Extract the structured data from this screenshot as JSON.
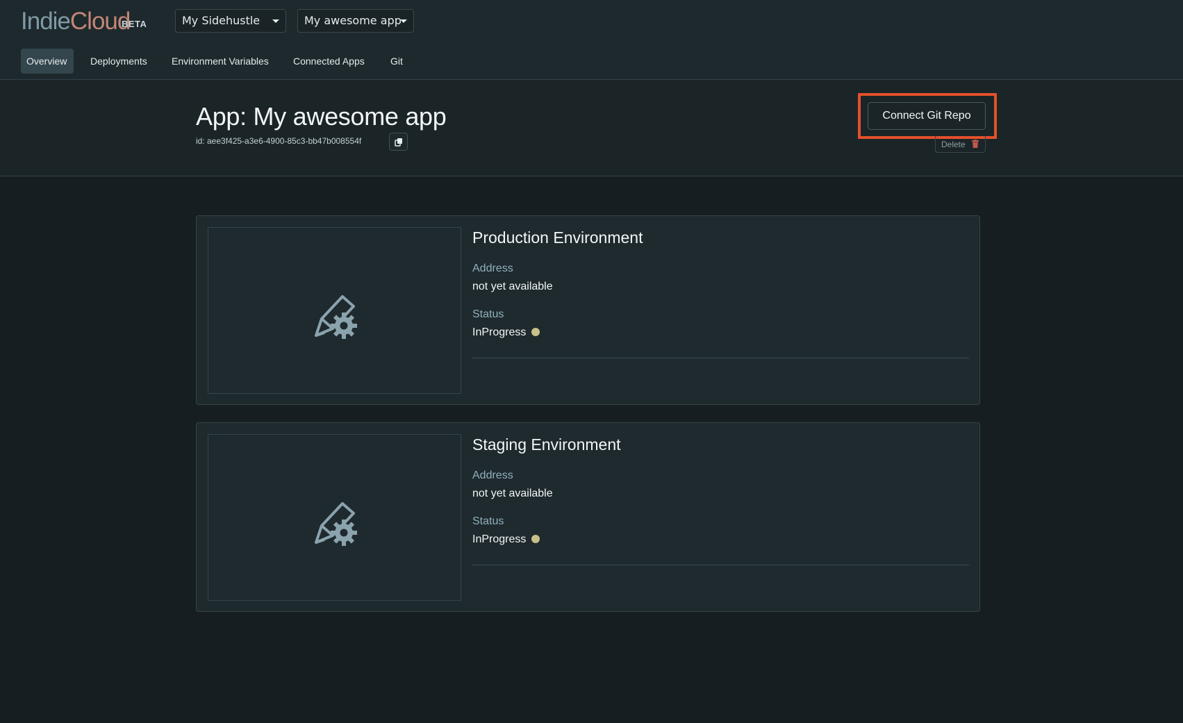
{
  "brand": {
    "name_part1": "Indie",
    "name_part2": "Cloud",
    "badge": "BETA"
  },
  "selectors": {
    "organization": "My Sidehustle",
    "app": "My awesome app"
  },
  "nav": {
    "items": [
      {
        "label": "Overview",
        "active": true
      },
      {
        "label": "Deployments"
      },
      {
        "label": "Environment Variables"
      },
      {
        "label": "Connected Apps"
      },
      {
        "label": "Git"
      }
    ]
  },
  "page": {
    "title": "App: My awesome app",
    "id_text": "id: aee3f425-a3e6-4900-85c3-bb47b008554f",
    "connect_label": "Connect Git Repo",
    "delete_label": "Delete"
  },
  "environments": [
    {
      "title": "Production Environment",
      "address_label": "Address",
      "address_value": "not yet available",
      "status_label": "Status",
      "status_value": "InProgress"
    },
    {
      "title": "Staging Environment",
      "address_label": "Address",
      "address_value": "not yet available",
      "status_label": "Status",
      "status_value": "InProgress"
    }
  ],
  "icons": {
    "copy": "copy-icon",
    "trash": "trash-icon",
    "environment": "pencil-gear-icon",
    "caret": "caret-down-icon"
  },
  "colors": {
    "highlight": "#e4502b",
    "status_in_progress": "#c7c188",
    "brand_indie": "#7f9aa4",
    "brand_cloud": "#c38676"
  }
}
